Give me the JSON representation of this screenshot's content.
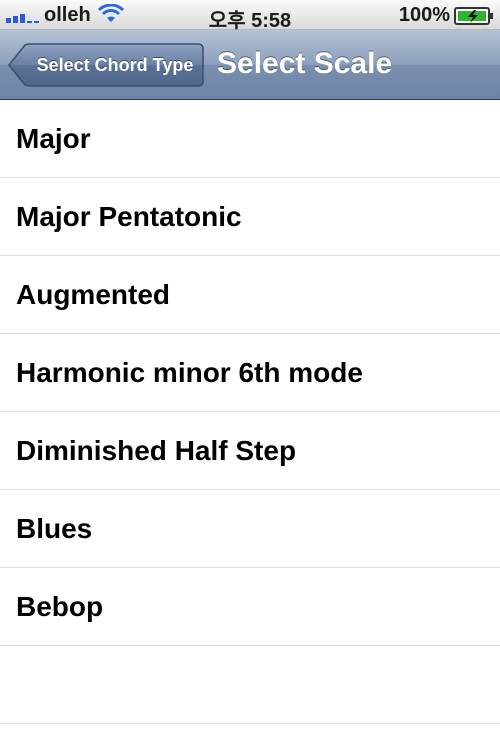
{
  "status_bar": {
    "carrier": "olleh",
    "time": "오후 5:58",
    "battery_percent": "100%",
    "icons": [
      "signal-icon",
      "wifi-icon",
      "battery-charging-icon"
    ]
  },
  "nav_bar": {
    "back_label": "Select Chord Type",
    "title": "Select Scale"
  },
  "scales": [
    {
      "label": "Major"
    },
    {
      "label": "Major Pentatonic"
    },
    {
      "label": "Augmented"
    },
    {
      "label": "Harmonic minor 6th mode"
    },
    {
      "label": "Diminished Half Step"
    },
    {
      "label": "Blues"
    },
    {
      "label": "Bebop"
    }
  ],
  "colors": {
    "nav_bar": "#7b8fae",
    "back_button": "#5a6f92",
    "separator": "#e0e0e0"
  }
}
